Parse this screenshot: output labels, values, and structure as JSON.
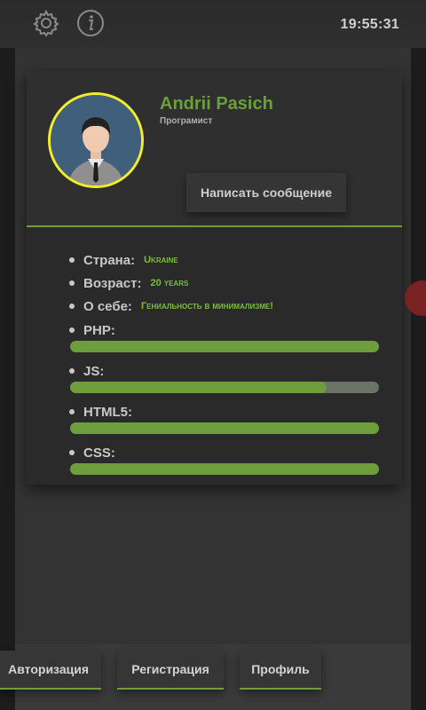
{
  "status": {
    "time": "19:55:31"
  },
  "topbar": {
    "settings_icon": "gear-icon",
    "info_icon": "info-icon"
  },
  "profile": {
    "name": "Andrii Pasich",
    "role": "Програмист",
    "message_button": "Написать сообщение",
    "accent_color": "#6a9f3a",
    "avatar_ring_color": "#f2ee2a"
  },
  "details": [
    {
      "label": "Страна:",
      "value": "Ukraine"
    },
    {
      "label": "Возраст:",
      "value": "20 years"
    },
    {
      "label": "О себе:",
      "value": "Гениальность в минимализме!"
    }
  ],
  "skills": [
    {
      "label": "PHP:",
      "level": 1.0
    },
    {
      "label": "JS:",
      "level": 0.83
    },
    {
      "label": "HTML5:",
      "level": 1.0
    },
    {
      "label": "CSS:",
      "level": 1.0
    }
  ],
  "bottom_nav": {
    "login": "Авторизация",
    "register": "Регистрация",
    "profile": "Профиль"
  }
}
